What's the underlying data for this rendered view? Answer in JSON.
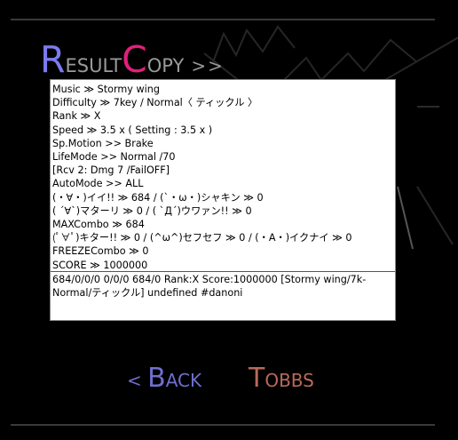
{
  "title": {
    "first_cap": "R",
    "first_rest": "ESULT",
    "second_cap": "C",
    "second_rest": "OPY",
    "arrows": ">>"
  },
  "result_lines": [
    "Music ≫ Stormy wing",
    "Difficulty ≫ 7key / Normal〈 ティックル 〉",
    "Rank ≫ X",
    "Speed ≫ 3.5 x ( Setting : 3.5 x )",
    "Sp.Motion >> Brake",
    "LifeMode >> Normal /70",
    " [Rcv 2: Dmg 7 /FailOFF]",
    "AutoMode >> ALL",
    "(・∀・)イイ!! ≫ 684 / (`・ω・)シャキン ≫ 0",
    "( ´∀`)マターリ ≫ 0 / ( `Д´)ウワァン!! ≫ 0",
    "MAXCombo ≫ 684",
    "(ﾟ∀ﾟ)キター!! ≫ 0 / (^ω^)セフセフ ≫ 0 / (・A・)イクナイ ≫ 0",
    "FREEZECombo ≫ 0",
    "SCORE ≫ 1000000"
  ],
  "share_text": "684/0/0/0 0/0/0 684/0 Rank:X Score:1000000 [Stormy wing/7k-Normal/ティックル] undefined #danoni",
  "buttons": {
    "back": {
      "prefix": "< ",
      "cap": "B",
      "rest": "ACK"
    },
    "tw": {
      "cap": "T",
      "rest": "OBBS"
    }
  },
  "colors": {
    "accent_blue": "#7b7bef",
    "accent_pink": "#e0207a",
    "back": "#6f6fcf",
    "tw": "#b86a5a"
  }
}
